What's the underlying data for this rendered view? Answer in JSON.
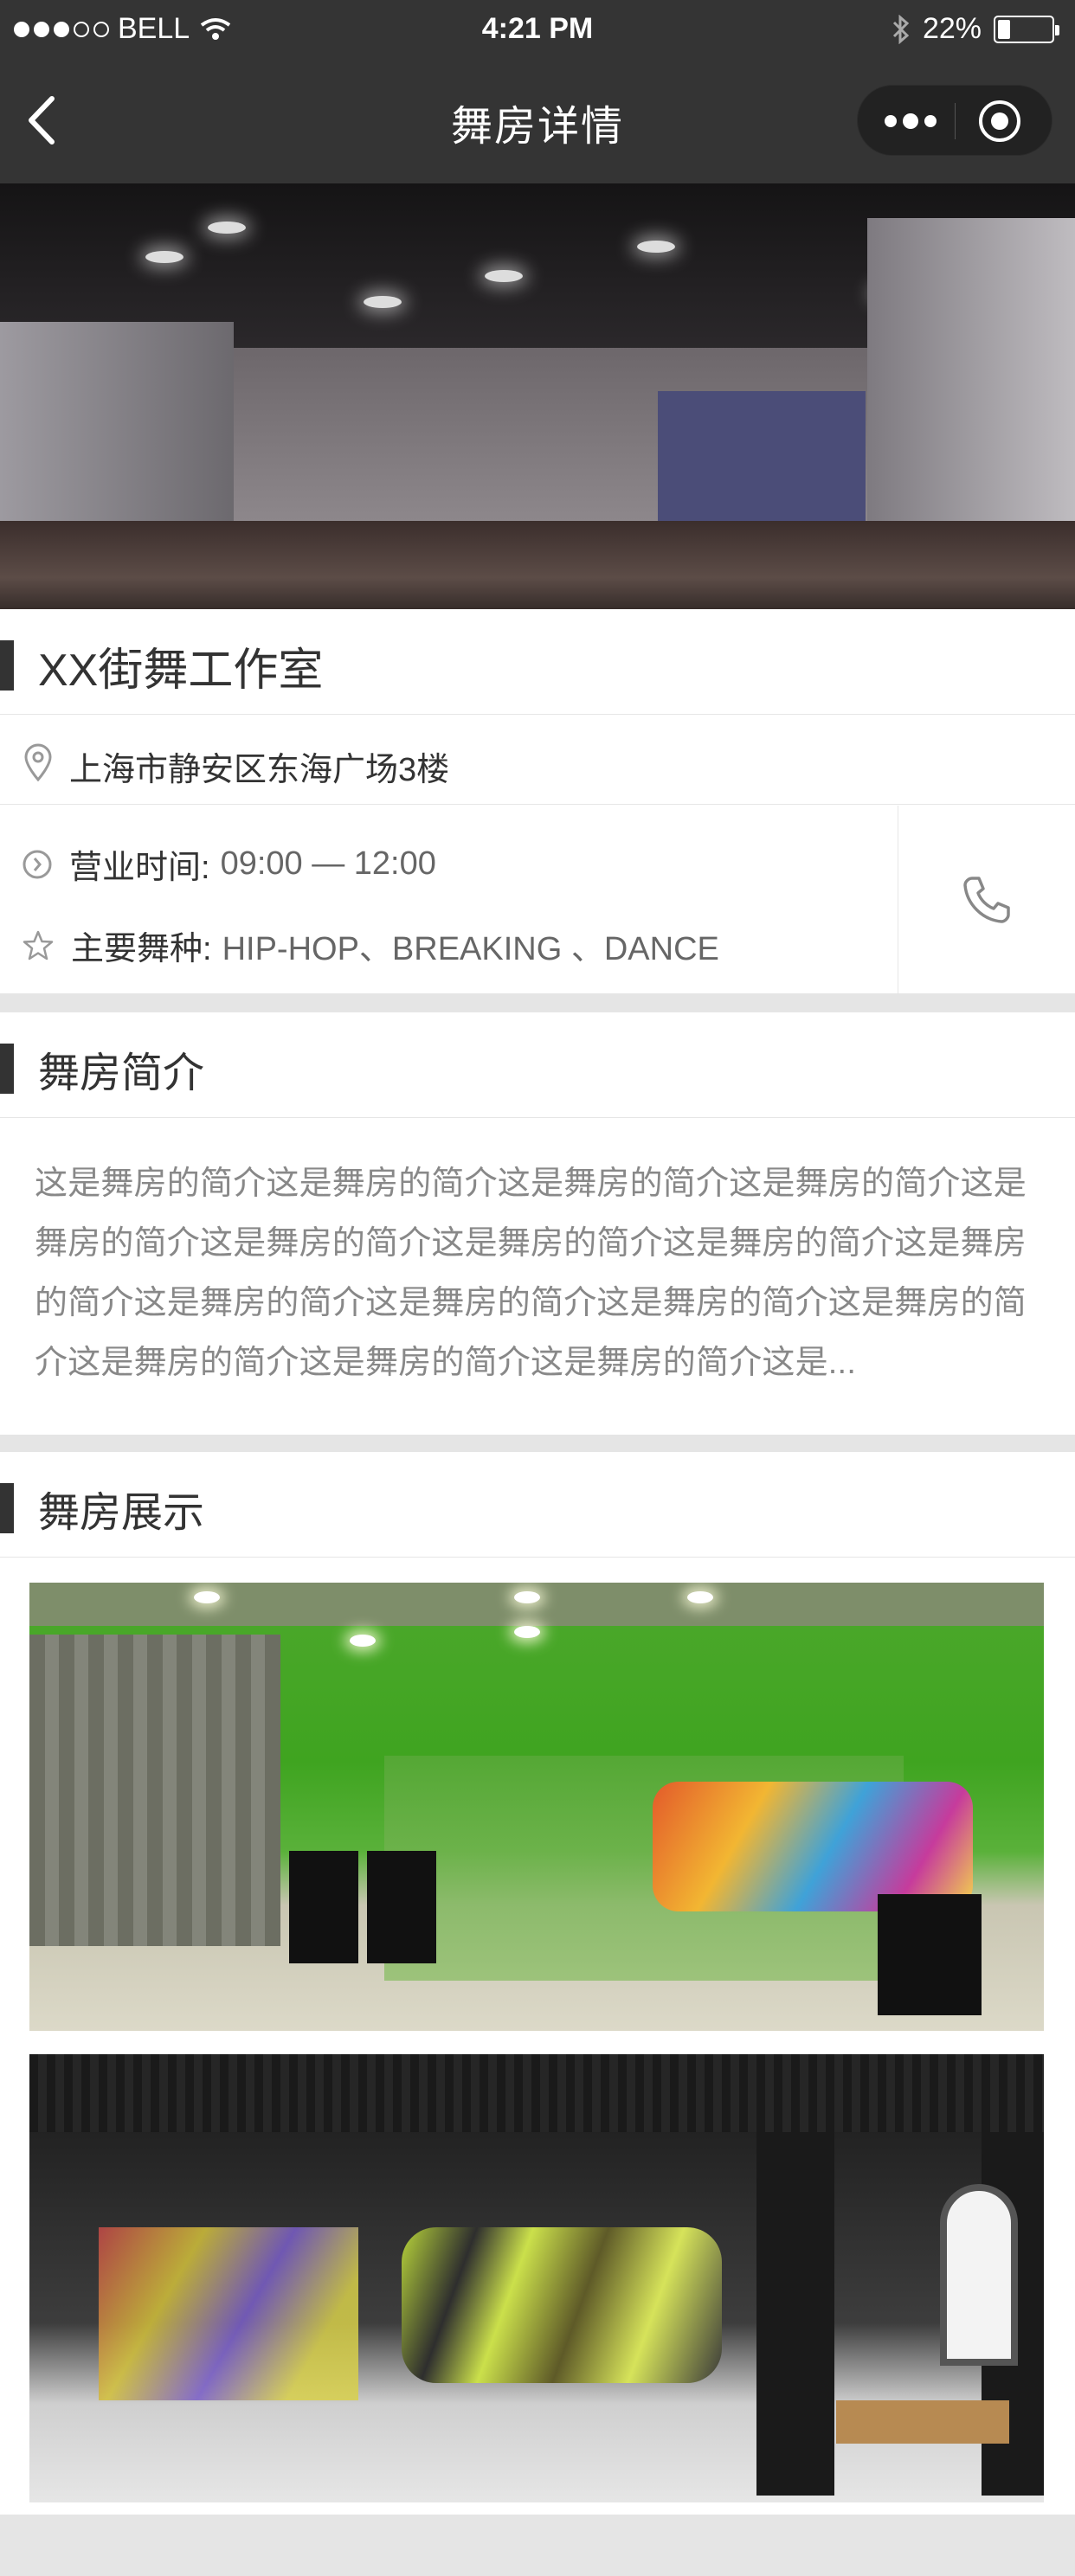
{
  "status_bar": {
    "carrier": "BELL",
    "time": "4:21 PM",
    "battery": "22%",
    "battery_level": 0.22,
    "signal_dots_filled": 3,
    "signal_dots_total": 5
  },
  "nav": {
    "title": "舞房详情",
    "back_icon": "chevron-left-icon",
    "more_icon": "more-dots-icon",
    "close_icon": "target-icon"
  },
  "studio": {
    "name": "XX街舞工作室",
    "address": "上海市静安区东海广场3楼",
    "hours_label": "营业时间:",
    "hours_value": "09:00 — 12:00",
    "dance_label": "主要舞种:",
    "dance_value": "HIP-HOP、BREAKING 、DANCE"
  },
  "intro": {
    "title": "舞房简介",
    "text": "这是舞房的简介这是舞房的简介这是舞房的简介这是舞房的简介这是舞房的简介这是舞房的简介这是舞房的简介这是舞房的简介这是舞房的简介这是舞房的简介这是舞房的简介这是舞房的简介这是舞房的简介这是舞房的简介这是舞房的简介这是舞房的简介这是..."
  },
  "gallery": {
    "title": "舞房展示"
  },
  "colors": {
    "nav_bg": "#343434",
    "page_bg": "#e5e5e5",
    "accent_bar": "#333333",
    "muted_text": "#888888"
  }
}
